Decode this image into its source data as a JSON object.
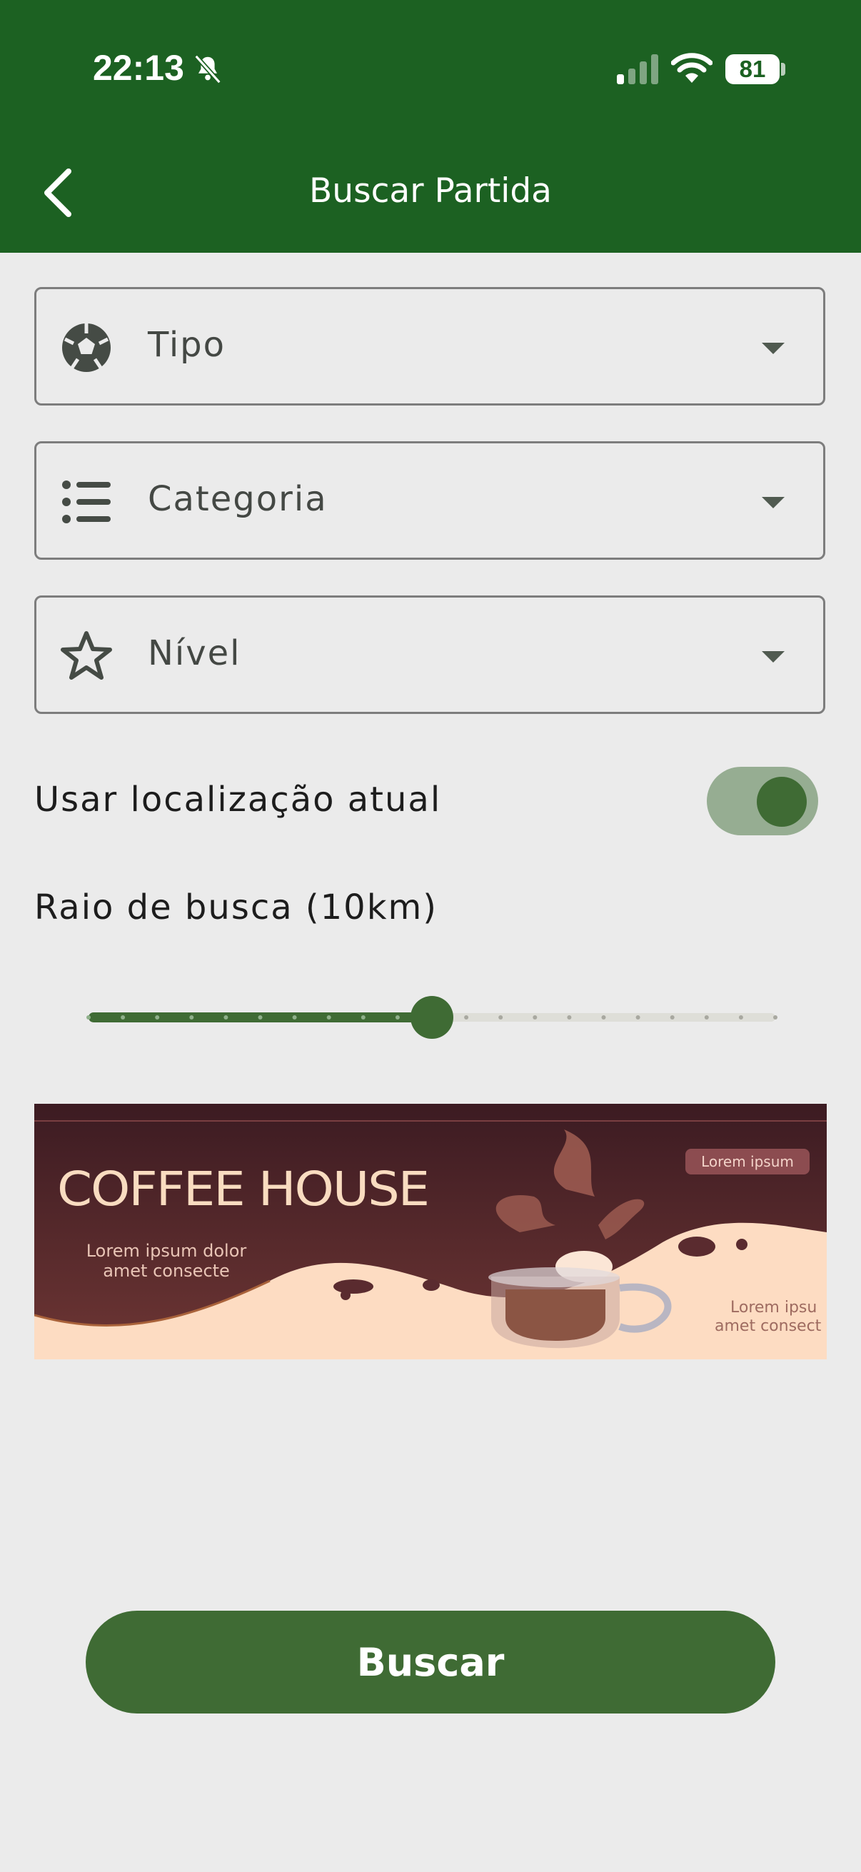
{
  "status_bar": {
    "time": "22:13",
    "battery": "81",
    "icons": [
      "bell-slash-icon",
      "cellular-signal-icon",
      "wifi-icon",
      "battery-icon"
    ]
  },
  "header": {
    "title": "Buscar Partida",
    "back_icon": "chevron-left-icon",
    "background_color": "#1c6122"
  },
  "filters": [
    {
      "label": "Tipo",
      "icon": "soccer-ball-icon"
    },
    {
      "label": "Categoria",
      "icon": "list-icon"
    },
    {
      "label": "Nível",
      "icon": "star-outline-icon"
    }
  ],
  "location_toggle": {
    "label": "Usar localização atual",
    "on": true
  },
  "radius_slider": {
    "label": "Raio de busca (10km)",
    "value_km": 10,
    "fraction": 0.5,
    "steps": 20
  },
  "banner": {
    "title": "COFFEE  HOUSE",
    "subtitle_line1": "Lorem ipsum dolor",
    "subtitle_line2": "amet  consecte",
    "badge": "Lorem ipsum",
    "side_line1": "Lorem ipsu",
    "side_line2": "amet  consect"
  },
  "search_button": {
    "label": "Buscar"
  },
  "colors": {
    "accent": "#3f6b34",
    "header": "#1c6122",
    "background": "#ebebeb",
    "toggle_track": "#96ad92"
  }
}
